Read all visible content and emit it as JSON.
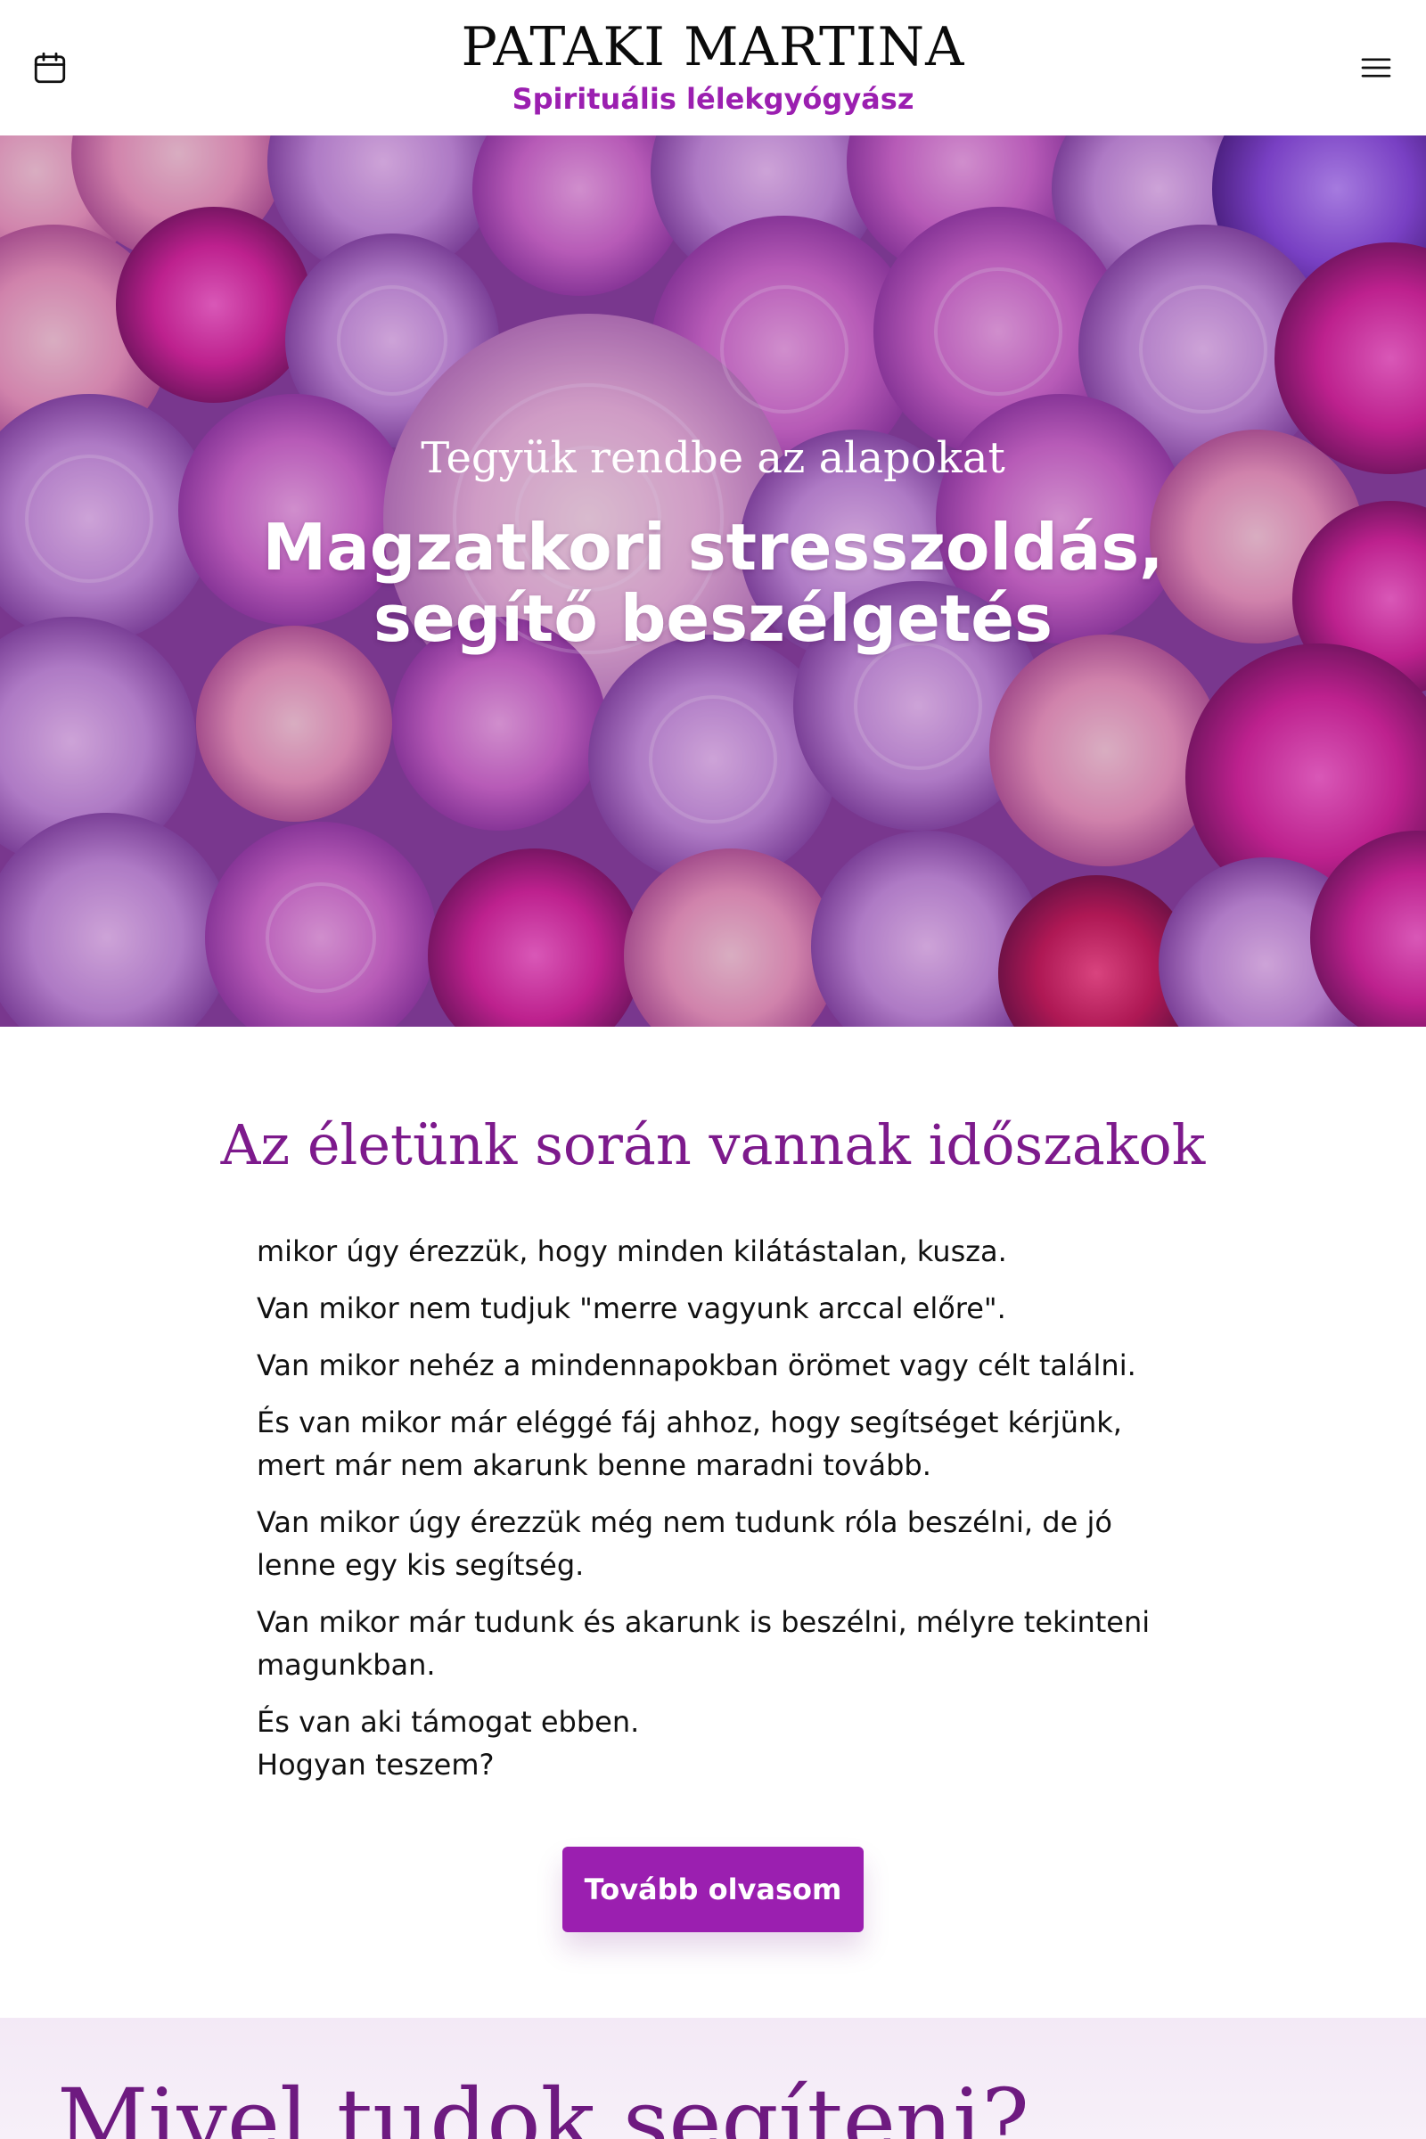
{
  "header": {
    "brand_name": "PATAKI MARTINA",
    "brand_subtitle": "Spirituális lélekgyógyász",
    "calendar_icon": "calendar-icon",
    "menu_icon": "hamburger-menu-icon"
  },
  "hero": {
    "kicker": "Tegyük rendbe az alapokat",
    "title": "Magzatkori stresszoldás, segítő beszélgetés"
  },
  "intro": {
    "heading": "Az életünk során vannak időszakok",
    "paragraphs": [
      "mikor úgy érezzük, hogy minden kilátástalan, kusza.",
      "Van mikor nem tudjuk \"merre vagyunk arccal előre\".",
      "Van mikor nehéz a mindennapokban örömet vagy célt találni.",
      "És van mikor már eléggé fáj ahhoz, hogy segítséget kérjünk, mert már nem akarunk benne maradni tovább.",
      "Van mikor úgy érezzük még nem tudunk róla beszélni, de jó lenne egy kis segítség.",
      "Van mikor már tudunk és akarunk is beszélni, mélyre tekinteni magunkban.",
      "És van aki támogat ebben.",
      "Hogyan teszem?"
    ],
    "cta_label": "Tovább olvasom"
  },
  "next_section": {
    "heading": "Mivel tudok segíteni?"
  },
  "colors": {
    "accent": "#9b1fb0",
    "heading_purple": "#7d1a8c"
  }
}
